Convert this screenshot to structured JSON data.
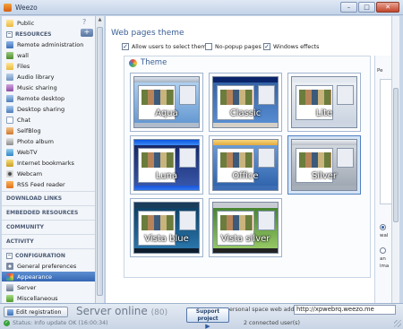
{
  "window": {
    "title": "Weezo",
    "min_glyph": "–",
    "max_glyph": "□",
    "close_glyph": "✕"
  },
  "sidebar": {
    "help_glyph": "?",
    "add_glyph": "+",
    "top_item": {
      "label": "Public",
      "icon": "folder-icon"
    },
    "resources_header": {
      "toggle": "−",
      "label": "RESOURCES"
    },
    "resources": [
      {
        "label": "Remote administration",
        "icon": "remote-icon"
      },
      {
        "label": "wall",
        "icon": "wall-icon"
      },
      {
        "label": "Files",
        "icon": "folder-icon"
      },
      {
        "label": "Audio library",
        "icon": "audio-icon"
      },
      {
        "label": "Music sharing",
        "icon": "music-icon"
      },
      {
        "label": "Remote desktop",
        "icon": "desktop-icon"
      },
      {
        "label": "Desktop sharing",
        "icon": "desktop-share-icon"
      },
      {
        "label": "Chat",
        "icon": "chat-icon"
      },
      {
        "label": "SelfBlog",
        "icon": "blog-icon"
      },
      {
        "label": "Photo album",
        "icon": "photo-icon"
      },
      {
        "label": "WebTV",
        "icon": "tv-icon"
      },
      {
        "label": "Internet bookmarks",
        "icon": "bookmark-icon"
      },
      {
        "label": "Webcam",
        "icon": "webcam-icon"
      },
      {
        "label": "RSS Feed reader",
        "icon": "rss-icon"
      }
    ],
    "sections": [
      {
        "label": "DOWNLOAD LINKS"
      },
      {
        "label": "EMBEDDED RESOURCES"
      },
      {
        "label": "COMMUNITY"
      },
      {
        "label": "ACTIVITY"
      }
    ],
    "configuration_header": {
      "toggle": "−",
      "label": "CONFIGURATION"
    },
    "configuration": [
      {
        "label": "General preferences",
        "icon": "gear-icon",
        "selected": false
      },
      {
        "label": "Appearance",
        "icon": "palette-icon",
        "selected": true
      },
      {
        "label": "Server",
        "icon": "server-icon",
        "selected": false
      },
      {
        "label": "Miscellaneous",
        "icon": "misc-icon",
        "selected": false
      }
    ]
  },
  "main": {
    "section_title": "Web pages theme",
    "checkboxes": [
      {
        "label": "Allow users to select theme",
        "checked": true,
        "mark": "✓"
      },
      {
        "label": "No-popup pages",
        "checked": false,
        "mark": ""
      },
      {
        "label": "Windows effects",
        "checked": true,
        "mark": "✓"
      }
    ],
    "theme_title": "Theme",
    "themes": [
      {
        "label": "Aqua",
        "selected": false
      },
      {
        "label": "Classic",
        "selected": false
      },
      {
        "label": "Lite",
        "selected": false
      },
      {
        "label": "Luna",
        "selected": false
      },
      {
        "label": "Office",
        "selected": false
      },
      {
        "label": "Silver",
        "selected": true
      },
      {
        "label": "Vista blue",
        "selected": false
      },
      {
        "label": "Vista silver",
        "selected": false
      }
    ],
    "right_panel": {
      "label_top": "Pe",
      "label_wal": "wal",
      "label_an": "an",
      "label_ima": "ima"
    }
  },
  "bottom": {
    "edit_registration": "Edit registration",
    "server_status": "Server online",
    "server_count": "(80)",
    "support_line1": "Support project",
    "support_play": "▶",
    "address_label": "ersonal space web address",
    "address_value": "http://xpwebrq.weezo.me",
    "status_text": "Status: Info update OK (16:00:34)",
    "connected_text": "2  connected user(s)"
  }
}
